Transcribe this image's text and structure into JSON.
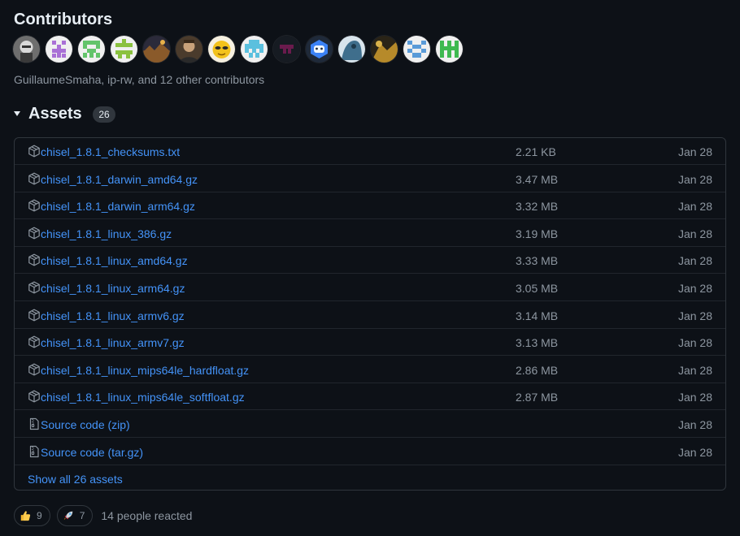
{
  "contributors": {
    "title": "Contributors",
    "summary": "GuillaumeSmaha, ip-rw, and 12 other contributors",
    "avatars": [
      {
        "name": "user-avatar-1",
        "style": "photo-gray"
      },
      {
        "name": "user-avatar-2",
        "style": "identicon-purple"
      },
      {
        "name": "user-avatar-3",
        "style": "identicon-green"
      },
      {
        "name": "user-avatar-4",
        "style": "identicon-green-2"
      },
      {
        "name": "user-avatar-5",
        "style": "photo-landscape"
      },
      {
        "name": "user-avatar-6",
        "style": "photo-person"
      },
      {
        "name": "user-avatar-7",
        "style": "photo-yellow-alien"
      },
      {
        "name": "user-avatar-8",
        "style": "identicon-cyan"
      },
      {
        "name": "user-avatar-9",
        "style": "identicon-dark-magenta"
      },
      {
        "name": "user-avatar-10",
        "style": "bot-blue"
      },
      {
        "name": "user-avatar-11",
        "style": "photo-blue"
      },
      {
        "name": "user-avatar-12",
        "style": "photo-gold"
      },
      {
        "name": "user-avatar-13",
        "style": "identicon-blue"
      },
      {
        "name": "user-avatar-14",
        "style": "identicon-green-3"
      }
    ]
  },
  "assets": {
    "title": "Assets",
    "count": "26",
    "rows": [
      {
        "name": "chisel_1.8.1_checksums.txt",
        "suffix": "",
        "size": "2.21 KB",
        "date": "Jan 28",
        "icon": "package-icon"
      },
      {
        "name": "chisel_1.8.1_darwin_amd64.gz",
        "suffix": "",
        "size": "3.47 MB",
        "date": "Jan 28",
        "icon": "package-icon"
      },
      {
        "name": "chisel_1.8.1_darwin_arm64.gz",
        "suffix": "",
        "size": "3.32 MB",
        "date": "Jan 28",
        "icon": "package-icon"
      },
      {
        "name": "chisel_1.8.1_linux_386.gz",
        "suffix": "",
        "size": "3.19 MB",
        "date": "Jan 28",
        "icon": "package-icon"
      },
      {
        "name": "chisel_1.8.1_linux_amd64.gz",
        "suffix": "",
        "size": "3.33 MB",
        "date": "Jan 28",
        "icon": "package-icon"
      },
      {
        "name": "chisel_1.8.1_linux_arm64.gz",
        "suffix": "",
        "size": "3.05 MB",
        "date": "Jan 28",
        "icon": "package-icon"
      },
      {
        "name": "chisel_1.8.1_linux_armv6.gz",
        "suffix": "",
        "size": "3.14 MB",
        "date": "Jan 28",
        "icon": "package-icon"
      },
      {
        "name": "chisel_1.8.1_linux_armv7.gz",
        "suffix": "",
        "size": "3.13 MB",
        "date": "Jan 28",
        "icon": "package-icon"
      },
      {
        "name": "chisel_1.8.1_linux_mips64le_hardfloat.gz",
        "suffix": "",
        "size": "2.86 MB",
        "date": "Jan 28",
        "icon": "package-icon"
      },
      {
        "name": "chisel_1.8.1_linux_mips64le_softfloat.gz",
        "suffix": "",
        "size": "2.87 MB",
        "date": "Jan 28",
        "icon": "package-icon"
      },
      {
        "name": "Source code",
        "suffix": " (zip)",
        "size": "",
        "date": "Jan 28",
        "icon": "file-zip-icon"
      },
      {
        "name": "Source code",
        "suffix": " (tar.gz)",
        "size": "",
        "date": "Jan 28",
        "icon": "file-zip-icon"
      }
    ],
    "show_all": "Show all 26 assets"
  },
  "reactions": {
    "items": [
      {
        "emoji": "thumbs-up-icon",
        "count": "9"
      },
      {
        "emoji": "rocket-icon",
        "count": "7"
      }
    ],
    "summary": "14 people reacted"
  },
  "colors": {
    "background": "#0d1117",
    "link": "#4493f8",
    "muted": "#8d96a0",
    "border": "#30363d"
  }
}
